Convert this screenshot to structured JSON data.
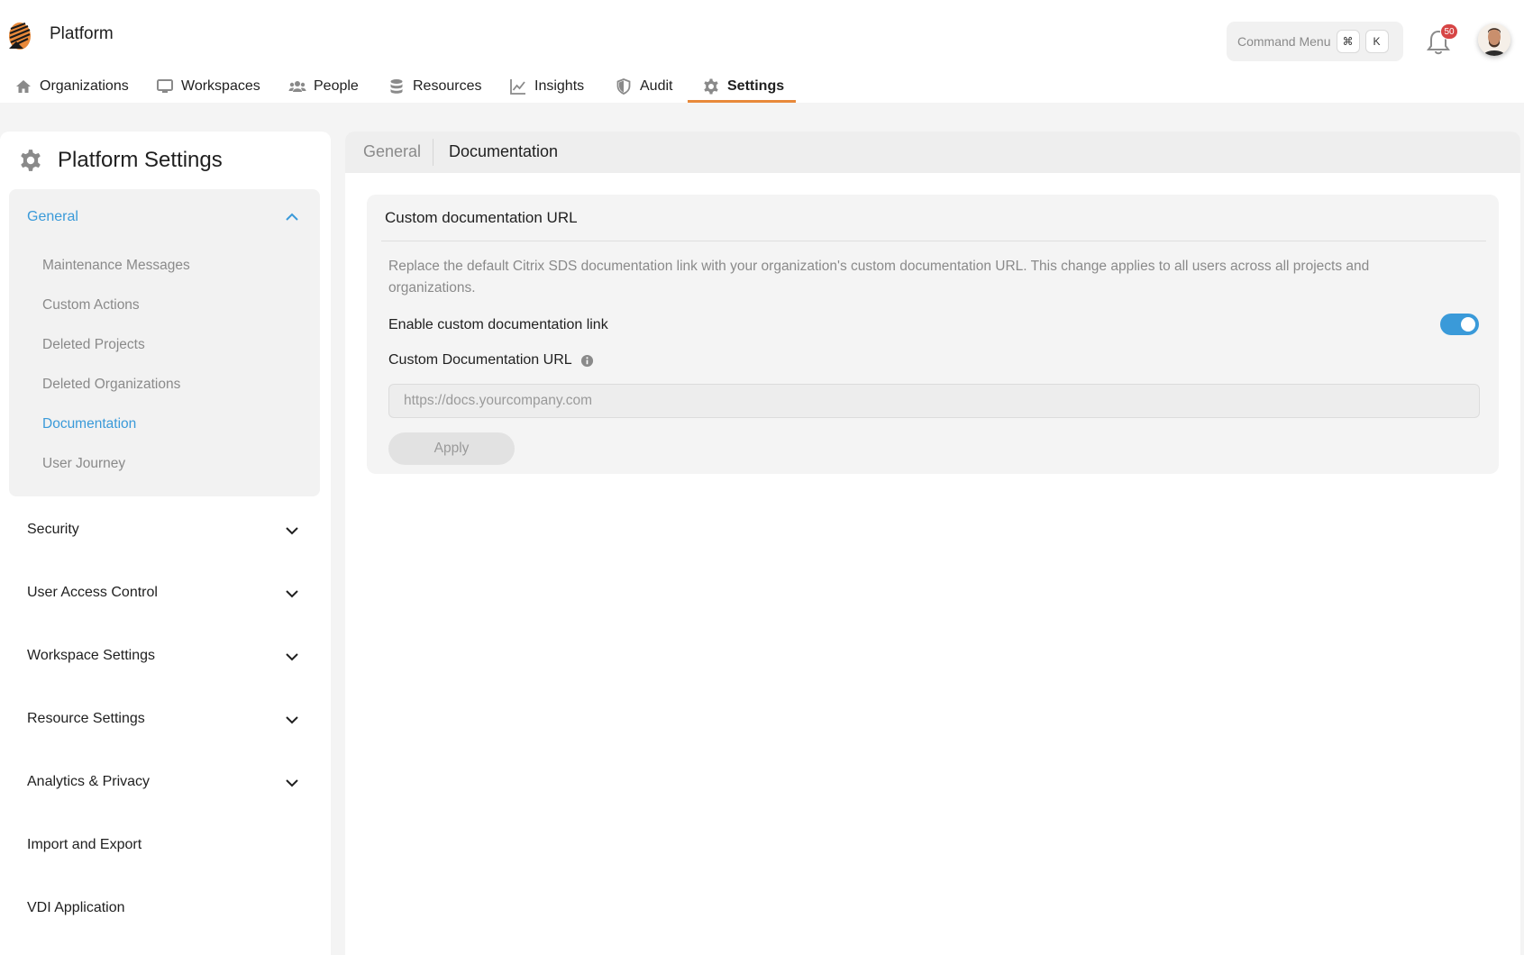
{
  "app": {
    "name": "Platform"
  },
  "command_menu": {
    "label": "Command Menu",
    "key1": "⌘",
    "key2": "K"
  },
  "notifications": {
    "count": "50"
  },
  "nav": {
    "items": [
      {
        "label": "Organizations",
        "icon": "home-icon"
      },
      {
        "label": "Workspaces",
        "icon": "monitor-icon"
      },
      {
        "label": "People",
        "icon": "people-icon"
      },
      {
        "label": "Resources",
        "icon": "database-icon"
      },
      {
        "label": "Insights",
        "icon": "chart-line-icon"
      },
      {
        "label": "Audit",
        "icon": "shield-icon"
      },
      {
        "label": "Settings",
        "icon": "gear-icon"
      }
    ],
    "active": "Settings"
  },
  "sidebar": {
    "title": "Platform Settings",
    "general": {
      "label": "General",
      "items": [
        "Maintenance Messages",
        "Custom Actions",
        "Deleted Projects",
        "Deleted Organizations",
        "Documentation",
        "User Journey"
      ],
      "active": "Documentation"
    },
    "sections": [
      "Security",
      "User Access Control",
      "Workspace Settings",
      "Resource Settings",
      "Analytics & Privacy",
      "Import and Export",
      "VDI Application"
    ]
  },
  "main": {
    "tabs": [
      "General",
      "Documentation"
    ],
    "card": {
      "title": "Custom documentation URL",
      "description": "Replace the default Citrix SDS documentation link with your organization's custom documentation URL. This change applies to all users across all projects and organizations.",
      "toggle_label": "Enable custom documentation link",
      "toggle_on": true,
      "url_label": "Custom Documentation URL",
      "url_placeholder": "https://docs.yourcompany.com",
      "url_value": "",
      "apply_label": "Apply"
    }
  },
  "colors": {
    "accent_blue": "#3a9ad9",
    "accent_orange": "#e8893a",
    "badge_red": "#d64545"
  }
}
